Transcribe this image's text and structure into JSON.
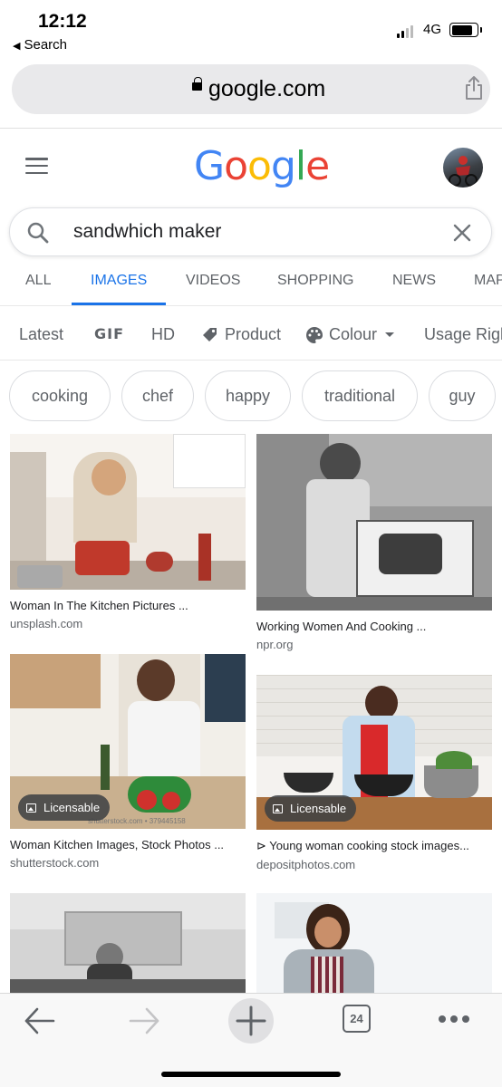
{
  "status_bar": {
    "time": "12:12",
    "back_label": "Search",
    "network": "4G",
    "icons": [
      "signal-icon",
      "battery-icon"
    ]
  },
  "address_bar": {
    "host": "google.com",
    "icons": [
      "lock-icon",
      "share-icon"
    ]
  },
  "header": {
    "logo_letters": [
      {
        "ch": "G",
        "color": "#4285F4"
      },
      {
        "ch": "o",
        "color": "#EA4335"
      },
      {
        "ch": "o",
        "color": "#FBBC05"
      },
      {
        "ch": "g",
        "color": "#4285F4"
      },
      {
        "ch": "l",
        "color": "#34A853"
      },
      {
        "ch": "e",
        "color": "#EA4335"
      }
    ]
  },
  "search": {
    "query": "sandwhich maker"
  },
  "tabs": [
    {
      "label": "ALL"
    },
    {
      "label": "IMAGES",
      "active": true
    },
    {
      "label": "VIDEOS"
    },
    {
      "label": "SHOPPING"
    },
    {
      "label": "NEWS"
    },
    {
      "label": "MAPS"
    }
  ],
  "filters": {
    "latest": "Latest",
    "gif": "GIF",
    "hd": "HD",
    "product": "Product",
    "colour": "Colour",
    "usage": "Usage Rights"
  },
  "chips": [
    "cooking",
    "chef",
    "happy",
    "traditional",
    "guy"
  ],
  "results": [
    {
      "caption": "Woman In The Kitchen Pictures ...",
      "domain": "unsplash.com"
    },
    {
      "caption": "Working Women And Cooking ...",
      "domain": "npr.org"
    },
    {
      "caption": "Woman Kitchen Images, Stock Photos ...",
      "domain": "shutterstock.com",
      "badge": "Licensable",
      "watermark": "shutterstock.com • 379445158"
    },
    {
      "caption": "⊳ Young woman cooking stock images...",
      "domain": "depositphotos.com",
      "badge": "Licensable"
    }
  ],
  "toolbar": {
    "tab_count": "24",
    "icons": [
      "back-arrow-icon",
      "forward-arrow-icon",
      "plus-icon",
      "tabs-icon",
      "more-icon"
    ]
  },
  "colors": {
    "accent": "#1a73e8",
    "text_secondary": "#5f6368"
  }
}
